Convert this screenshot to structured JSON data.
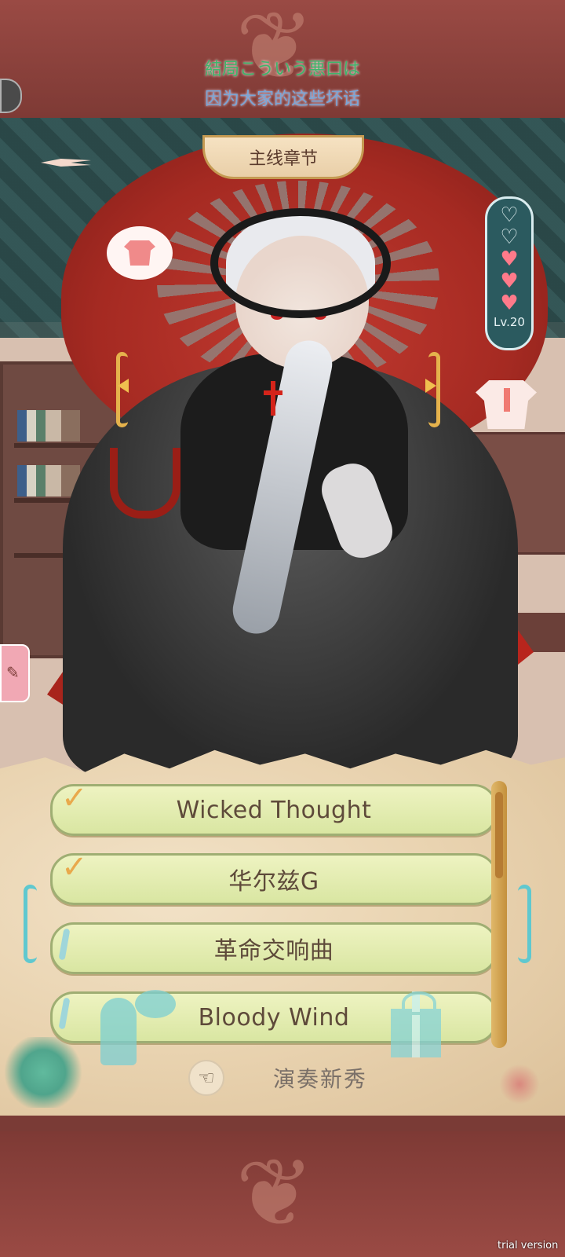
{
  "header": {
    "title_line1": "結局こういう悪口は",
    "title_line2": "因为大家的这些坏话",
    "chapter_label": "主线章节"
  },
  "affection": {
    "hearts_filled": 3,
    "hearts_total": 5,
    "level": "Lv.20"
  },
  "songs": [
    {
      "label": "Wicked Thought",
      "status": "done"
    },
    {
      "label": "华尔兹G",
      "status": "done"
    },
    {
      "label": "革命交响曲",
      "status": "locked"
    },
    {
      "label": "Bloody Wind",
      "status": "locked"
    }
  ],
  "perform": {
    "label": "演奏新秀"
  },
  "watermark": "trial version",
  "colors": {
    "frame": "#7a3b36",
    "song_bg": "#e3ecb2",
    "accent_gold": "#e5b24c",
    "accent_teal": "#5fc8cf"
  },
  "icons": {
    "back": "back-arrow-icon",
    "menu": "menu-icon",
    "outfit": "shirt-icon",
    "chat": "chat-icon",
    "gift": "gift-icon",
    "hand": "hand-icon",
    "note": "note-icon"
  }
}
